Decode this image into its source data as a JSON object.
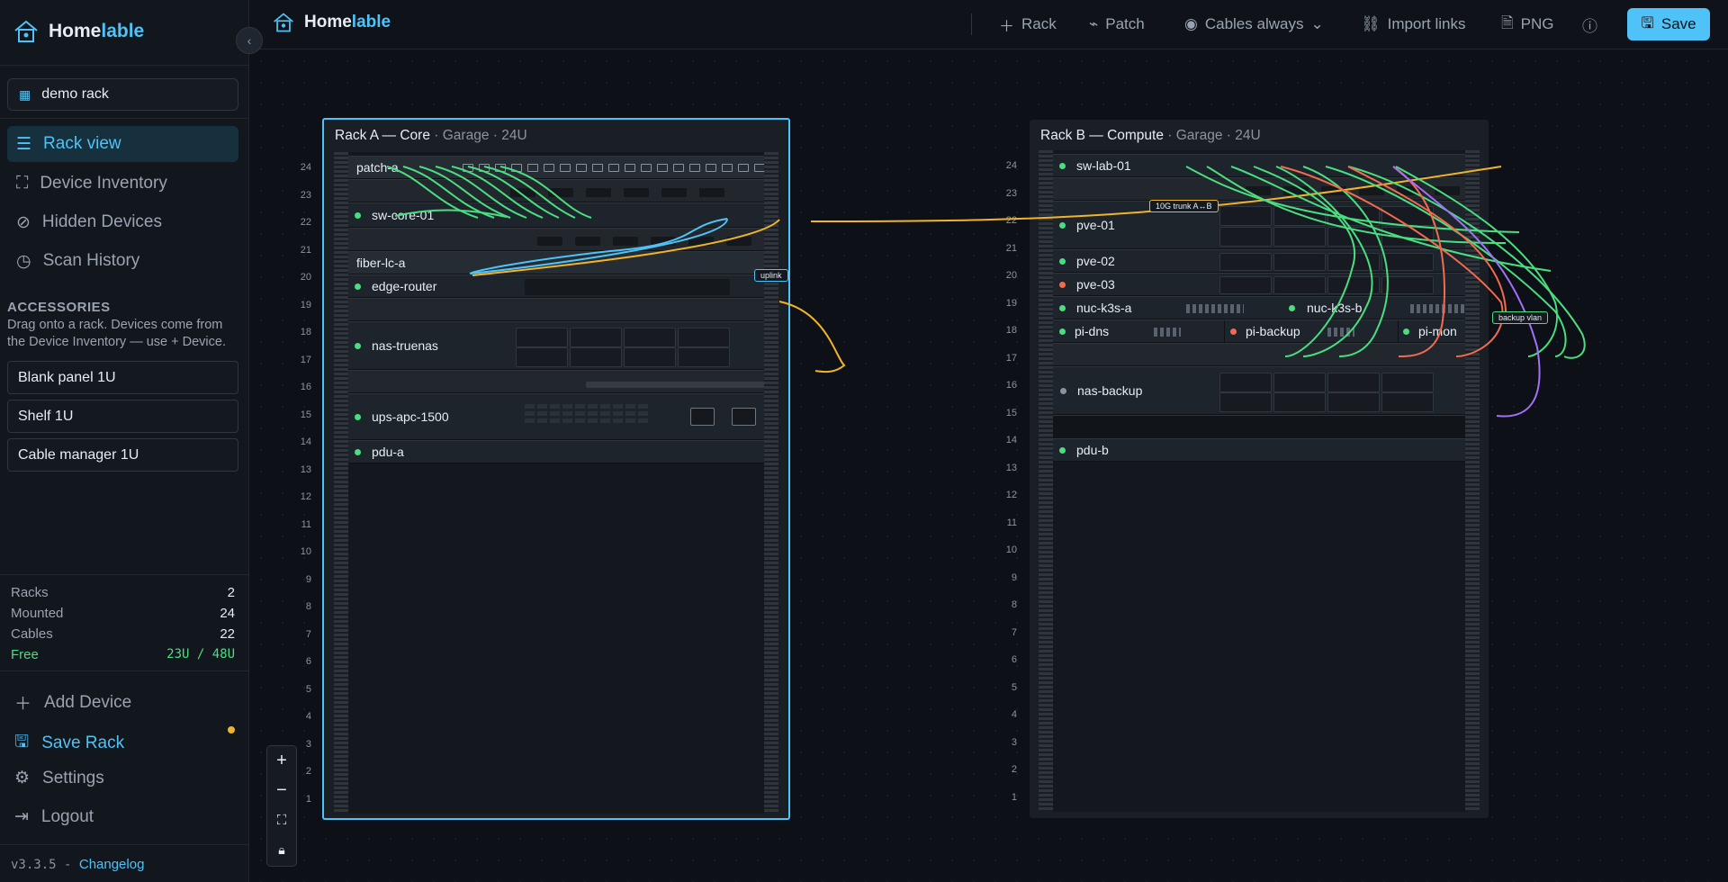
{
  "app": {
    "name_a": "Home",
    "name_b": "lable",
    "version": "v3.3.5 - ",
    "changelog": "Changelog"
  },
  "sidebar": {
    "rack_select": "demo rack",
    "nav": [
      {
        "label": "Rack view",
        "icon": "list-icon",
        "active": true
      },
      {
        "label": "Device Inventory",
        "icon": "scan-icon"
      },
      {
        "label": "Hidden Devices",
        "icon": "eye-off-icon"
      },
      {
        "label": "Scan History",
        "icon": "clock-icon"
      }
    ],
    "accessories_title": "ACCESSORIES",
    "accessories_desc": "Drag onto a rack. Devices come from the Device Inventory — use + Device.",
    "accessories": [
      "Blank panel 1U",
      "Shelf 1U",
      "Cable manager 1U"
    ],
    "stats": [
      {
        "label": "Racks",
        "value": "2"
      },
      {
        "label": "Mounted",
        "value": "24"
      },
      {
        "label": "Cables",
        "value": "22"
      },
      {
        "label": "Free",
        "value": "23U / 48U"
      }
    ],
    "bottom": [
      {
        "label": "Add Device",
        "icon": "plus-icon"
      },
      {
        "label": "Save Rack",
        "icon": "save-icon"
      },
      {
        "label": "Settings",
        "icon": "gear-icon"
      },
      {
        "label": "Logout",
        "icon": "logout-icon"
      }
    ]
  },
  "toolbar": {
    "rack": "Rack",
    "patch": "Patch",
    "cables": "Cables always",
    "import": "Import links",
    "png": "PNG",
    "save": "Save"
  },
  "racks": [
    {
      "title": "Rack A — Core",
      "subtitle": " · Garage · 24U",
      "devices": {
        "patch_a": "patch-a",
        "sw_core_01": "sw-core-01",
        "fiber_lc_a": "fiber-lc-a",
        "edge_router": "edge-router",
        "nas_truenas": "nas-truenas",
        "ups": "ups-apc-1500",
        "pdu_a": "pdu-a"
      }
    },
    {
      "title": "Rack B — Compute",
      "subtitle": " · Garage · 24U",
      "devices": {
        "sw_lab_01": "sw-lab-01",
        "pve_01": "pve-01",
        "pve_02": "pve-02",
        "pve_03": "pve-03",
        "nuc_a": "nuc-k3s-a",
        "nuc_b": "nuc-k3s-b",
        "pi_dns": "pi-dns",
        "pi_backup": "pi-backup",
        "pi_mon": "pi-mon",
        "nas_backup": "nas-backup",
        "pdu_b": "pdu-b"
      }
    }
  ],
  "cable_labels": {
    "uplink": "uplink",
    "trunk": "10G trunk A↔B",
    "backup": "backup vlan"
  },
  "colors": {
    "accent": "#4fc3f7",
    "ok": "#4ade80",
    "warn": "#f0b429",
    "error": "#f26b4f",
    "offline": "#8b949e",
    "purple": "#a371f7"
  }
}
